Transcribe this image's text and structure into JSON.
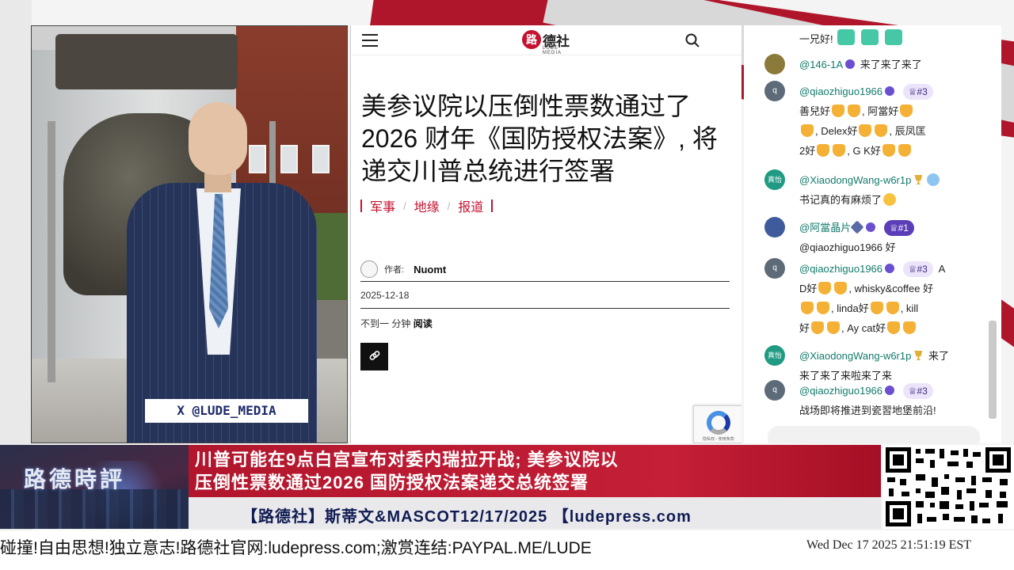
{
  "video": {
    "caption": "X @LUDE_MEDIA"
  },
  "article": {
    "brand_badge": "路",
    "brand_name": "德社",
    "brand_sub": "LUDE MEDIA",
    "headline": "美参议院以压倒性票数通过了 2026 财年《国防授权法案》, 将递交川普总统进行签署",
    "categories": [
      "军事",
      "地缘",
      "报道"
    ],
    "author_label": "作者:",
    "author_name": "Nuomt",
    "date": "2025-12-18",
    "read_time": "不到一 分钟",
    "read_label": "阅读",
    "recaptcha_text": "隐私权 - 使用条款"
  },
  "chat": {
    "top_line": "一兄好!",
    "messages": [
      {
        "avatar_color": "#8b7a3a",
        "avatar_text": "",
        "user": "@146-1A",
        "text": "来了来了来了"
      },
      {
        "avatar_color": "#5d6a78",
        "avatar_text": "q",
        "user": "@qiaozhiguo1966",
        "rank": "#3",
        "line1": "善兒好",
        "line1b": ", 阿當好",
        "line2": ", Delex好",
        "line2b": ", 辰凤匡",
        "line3": "2好",
        "line3b": ", G K好"
      },
      {
        "avatar_color": "#1f9a83",
        "avatar_text": "真怡",
        "user": "@XiaodongWang-w6r1p",
        "text": "书记真的有麻烦了"
      },
      {
        "avatar_color": "#3f5b9c",
        "avatar_text": "",
        "user": "@阿當晶片",
        "rank": "#1",
        "text": "@qiaozhiguo1966 好"
      },
      {
        "avatar_color": "#5d6a78",
        "avatar_text": "q",
        "user": "@qiaozhiguo1966",
        "rank": "#3",
        "tail": "A",
        "line1": "D好",
        "line1b": ", whisky&coffee 好",
        "line2b": ", linda好",
        "line2c": ", kill",
        "line3": "好",
        "line3b": ", Ay cat好"
      },
      {
        "avatar_color": "#1f9a83",
        "avatar_text": "真怡",
        "user": "@XiaodongWang-w6r1p",
        "tail": "来了",
        "text": "来了来了来啦来了来"
      },
      {
        "avatar_color": "#5d6a78",
        "avatar_text": "q",
        "user": "@qiaozhiguo1966",
        "rank": "#3",
        "text": "战场即将推进到瓷習地堡前沿!"
      }
    ]
  },
  "lower_third": {
    "logo_text": "路德時評",
    "headline_line1": "川普可能在9点白宫宣布对委内瑞拉开战; 美参议院以",
    "headline_line2": "压倒性票数通过2026 国防授权法案递交总统签署",
    "show_text": "【路德社】斯蒂文&MASCOT12/17/2025 【ludepress.com"
  },
  "bottom": {
    "marquee": "碰撞!自由思想!独立意志!路德社官网:ludepress.com;激赏连结:PAYPAL.ME/LUDE",
    "clock": "Wed Dec 17 2025 21:51:19 EST"
  },
  "colors": {
    "brand_red": "#c4122f",
    "lower_red": "#b1162d",
    "navy_text": "#101c52",
    "chat_user": "#127a6c"
  },
  "icons": [
    "menu-icon",
    "search-icon",
    "link-icon",
    "recaptcha-icon",
    "crown-icon",
    "moderator-badge-icon",
    "trophy-icon",
    "wrench-icon",
    "pray-hands-emoji",
    "grin-emoji",
    "scream-emoji"
  ]
}
